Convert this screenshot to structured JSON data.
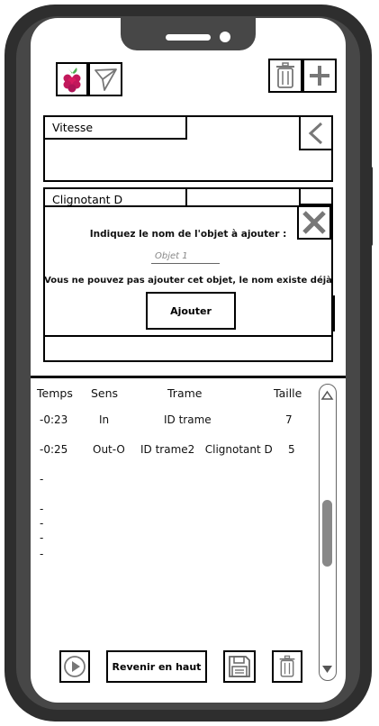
{
  "toolbar": {
    "raspberry_icon": "raspberry-icon",
    "send_icon": "paper-plane-icon",
    "trash_icon": "trash-icon",
    "add_icon": "plus-icon"
  },
  "objects": [
    {
      "label": "Vitesse",
      "action_icon": "chevron-left-icon"
    },
    {
      "label": "Clignotant D",
      "action_icon": "close-icon"
    }
  ],
  "dialog": {
    "title": "Indiquez le nom de l'objet à ajouter :",
    "input_placeholder": "Objet 1",
    "error": "Vous ne pouvez pas ajouter cet objet, le nom existe déjà",
    "submit_label": "Ajouter",
    "close_icon": "close-icon"
  },
  "log": {
    "headers": {
      "time": "Temps",
      "direction": "Sens",
      "frame": "Trame",
      "size": "Taille"
    },
    "rows": [
      {
        "time": "-0:23",
        "direction": "In",
        "frame": "ID trame",
        "size": "7"
      },
      {
        "time": "-0:25",
        "direction": "Out-O",
        "frame": "ID trame2   Clignotant D",
        "size": "5"
      },
      {
        "time": "-"
      },
      {
        "time": "-"
      },
      {
        "time": "-"
      },
      {
        "time": "-"
      },
      {
        "time": "-"
      }
    ]
  },
  "bottom_bar": {
    "play_icon": "play-icon",
    "back_to_top_label": "Revenir en haut",
    "save_icon": "floppy-disk-icon",
    "trash_icon": "trash-icon"
  }
}
